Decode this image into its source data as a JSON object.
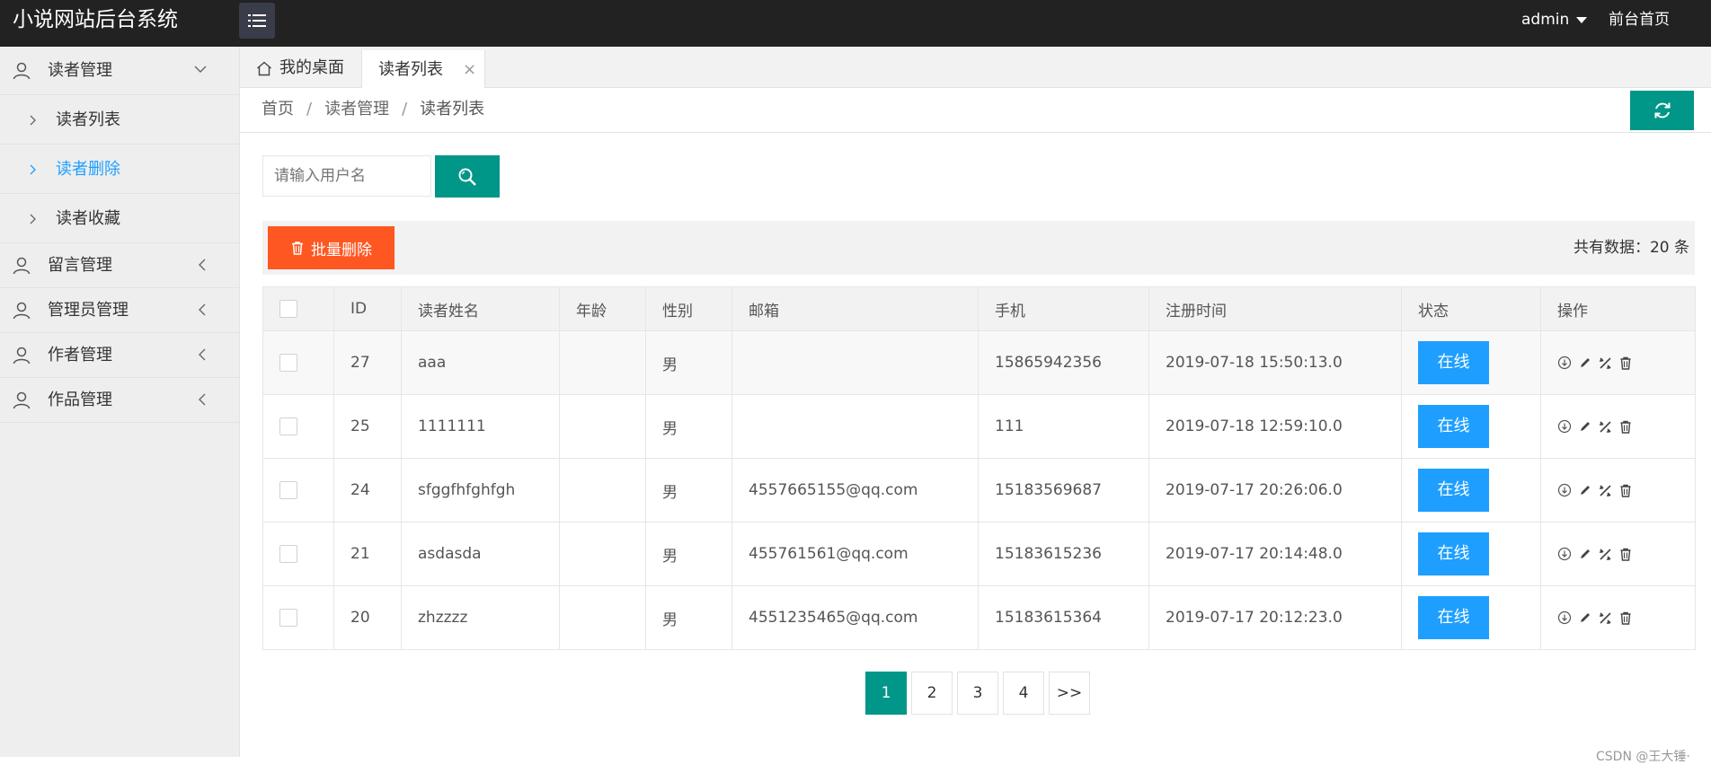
{
  "app": {
    "title": "小说网站后台系统",
    "user": "admin",
    "front_link": "前台首页"
  },
  "sidebar": {
    "groups": [
      {
        "label": "读者管理",
        "expanded": true,
        "items": [
          "读者列表",
          "读者删除",
          "读者收藏"
        ],
        "active_item": "读者删除"
      },
      {
        "label": "留言管理",
        "expanded": false
      },
      {
        "label": "管理员管理",
        "expanded": false
      },
      {
        "label": "作者管理",
        "expanded": false
      },
      {
        "label": "作品管理",
        "expanded": false
      }
    ]
  },
  "tabs": {
    "home": "我的桌面",
    "current": "读者列表",
    "close": "×"
  },
  "breadcrumb": {
    "items": [
      "首页",
      "读者管理",
      "读者列表"
    ],
    "separator": "/"
  },
  "search": {
    "placeholder": "请输入用户名",
    "value": ""
  },
  "toolbar": {
    "batch_delete": "批量删除",
    "total_text": "共有数据：20 条"
  },
  "table": {
    "headers": [
      "ID",
      "读者姓名",
      "年龄",
      "性别",
      "邮箱",
      "手机",
      "注册时间",
      "状态",
      "操作"
    ],
    "rows": [
      {
        "id": "27",
        "name": "aaa",
        "age": "",
        "gender": "男",
        "email": "",
        "phone": "15865942356",
        "registered": "2019-07-18 15:50:13.0",
        "status": "在线"
      },
      {
        "id": "25",
        "name": "1111111",
        "age": "",
        "gender": "男",
        "email": "",
        "phone": "111",
        "registered": "2019-07-18 12:59:10.0",
        "status": "在线"
      },
      {
        "id": "24",
        "name": "sfggfhfghfgh",
        "age": "",
        "gender": "男",
        "email": "4557665155@qq.com",
        "phone": "15183569687",
        "registered": "2019-07-17 20:26:06.0",
        "status": "在线"
      },
      {
        "id": "21",
        "name": "asdasda",
        "age": "",
        "gender": "男",
        "email": "455761561@qq.com",
        "phone": "15183615236",
        "registered": "2019-07-17 20:14:48.0",
        "status": "在线"
      },
      {
        "id": "20",
        "name": "zhzzzz",
        "age": "",
        "gender": "男",
        "email": "4551235465@qq.com",
        "phone": "15183615364",
        "registered": "2019-07-17 20:12:23.0",
        "status": "在线"
      }
    ]
  },
  "pagination": {
    "pages": [
      "1",
      "2",
      "3",
      "4"
    ],
    "next": ">>",
    "current": "1"
  },
  "watermark": "CSDN @王大锤·",
  "colors": {
    "topbar": "#222222",
    "primary": "#009688",
    "danger": "#FF5722",
    "info": "#1E9FFF"
  }
}
